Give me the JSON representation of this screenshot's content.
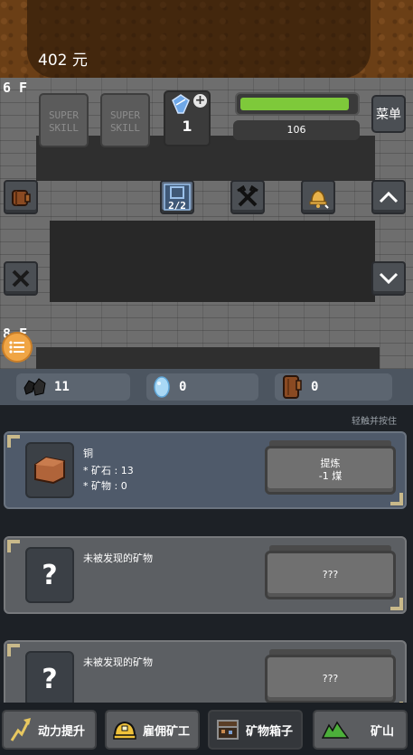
{
  "header": {
    "money": "402 元"
  },
  "floors": {
    "current": "6 F",
    "next": "8 F"
  },
  "skills": [
    {
      "label": "SUPER SKILL"
    },
    {
      "label": "SUPER SKILL"
    }
  ],
  "gem": {
    "count": "1",
    "plus": "+"
  },
  "health": {
    "value": "106",
    "fill_fraction": 0.95
  },
  "menu": {
    "label": "菜单"
  },
  "miners_card": {
    "label": "2/2"
  },
  "resources": [
    {
      "name": "coal",
      "value": "11"
    },
    {
      "name": "crystal",
      "value": "0"
    },
    {
      "name": "wood",
      "value": "0"
    }
  ],
  "hint": "轻触并按住",
  "ores": [
    {
      "name": "铜",
      "stat1": "* 矿石 : 13",
      "stat2": "* 矿物 : 0",
      "button_line1": "提炼",
      "button_line2": "-1 煤"
    },
    {
      "name": "未被发现的矿物",
      "unknown": "?",
      "button": "???"
    },
    {
      "name": "未被发现的矿物",
      "unknown": "?",
      "button": "???"
    }
  ],
  "nav": [
    {
      "label": "动力提升"
    },
    {
      "label": "雇佣矿工"
    },
    {
      "label": "矿物箱子"
    },
    {
      "label": "矿山"
    }
  ],
  "colors": {
    "health_bar": "#7ec93a",
    "accent_orange": "#f0a545",
    "panel": "#4f5a6a"
  }
}
